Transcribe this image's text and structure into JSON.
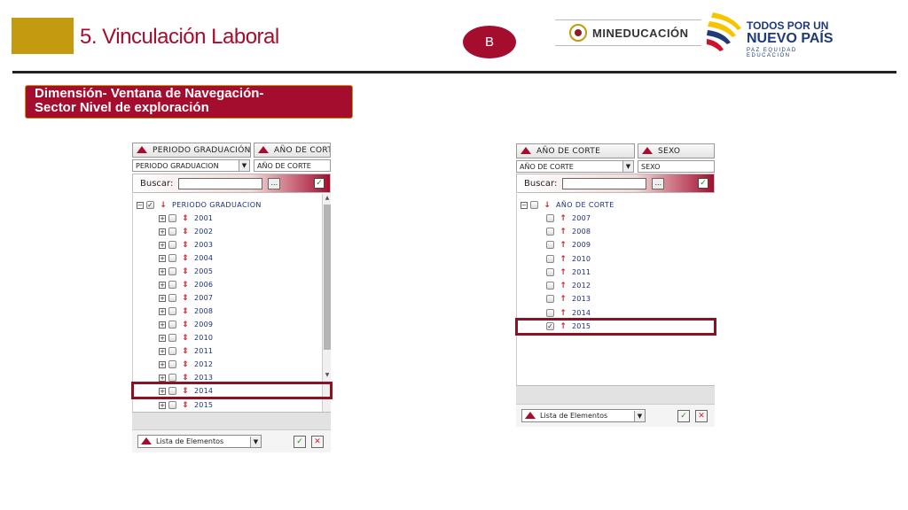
{
  "header": {
    "title": "5. Vinculación Laboral",
    "badge": "B",
    "logo_min": "MINEDUCACIÓN",
    "logo_tpu_line1": "TODOS POR UN",
    "logo_tpu_line2": "NUEVO PAÍS",
    "logo_tpu_line3": "PAZ  EQUIDAD  EDUCACIÓN"
  },
  "section": {
    "line1": "Dimensión- Ventana de Navegación-",
    "line2": "Sector Nivel de exploración"
  },
  "colors": {
    "brand": "#a50d2e",
    "gold": "#c39a10",
    "link": "#1a2e78"
  },
  "left_widget": {
    "tab1": "PERIODO GRADUACIÓN",
    "tab2": "AÑO DE CORTE",
    "select1": "PERIODO GRADUACION",
    "select2": "AÑO DE CORTE",
    "search_label": "Buscar:",
    "root": "PERIODO GRADUACION",
    "items": [
      "2001",
      "2002",
      "2003",
      "2004",
      "2005",
      "2006",
      "2007",
      "2008",
      "2009",
      "2010",
      "2011",
      "2012",
      "2013",
      "2014",
      "2015"
    ],
    "footer_select": "Lista de Elementos"
  },
  "right_widget": {
    "tab1": "AÑO DE CORTE",
    "tab2": "SEXO",
    "select1": "AÑO DE CORTE",
    "select2": "SEXO",
    "search_label": "Buscar:",
    "root": "AÑO DE CORTE",
    "items": [
      "2007",
      "2008",
      "2009",
      "2010",
      "2011",
      "2012",
      "2013",
      "2014",
      "2015"
    ],
    "footer_select": "Lista de Elementos"
  }
}
